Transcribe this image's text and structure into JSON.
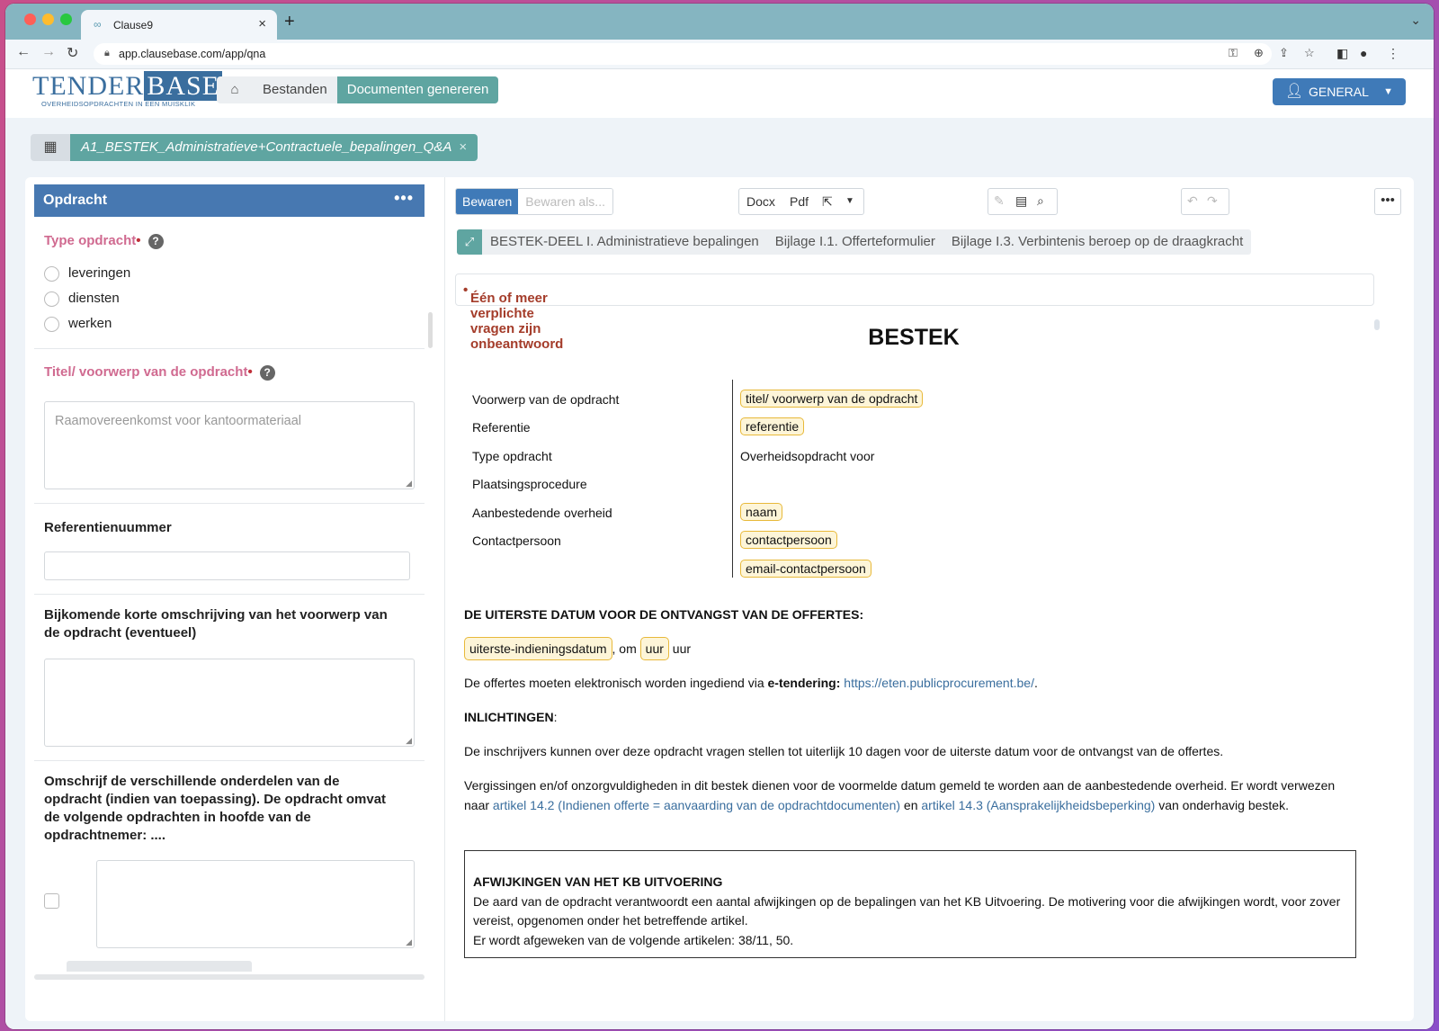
{
  "browser": {
    "tab_title": "Clause9",
    "url": "app.clausebase.com/app/qna"
  },
  "header": {
    "logo_main": "TENDER",
    "logo_accent": "BASE",
    "logo_tagline": "OVERHEIDSOPDRACHTEN IN EEN MUISKLIK",
    "nav_files": "Bestanden",
    "nav_generate": "Documenten genereren",
    "user_label": "GENERAL"
  },
  "document_tab": "A1_BESTEK_Administratieve+Contractuele_bepalingen_Q&A",
  "left_panel": {
    "title": "Opdracht",
    "q_type": "Type opdracht",
    "q_type_options": [
      "leveringen",
      "diensten",
      "werken"
    ],
    "q_title": "Titel/ voorwerp van de opdracht",
    "q_title_placeholder": "Raamovereenkomst voor kantoormateriaal",
    "q_reference": "Referentienuummer",
    "q_short_desc": "Bijkomende korte omschrijving van het voorwerp van de opdracht (eventueel)",
    "q_parts": "Omschrijf de verschillende onderdelen van de opdracht (indien van toepassing). De opdracht omvat de volgende opdrachten in hoofde van de opdrachtnemer: ...."
  },
  "toolbar": {
    "save": "Bewaren",
    "save_as": "Bewaren als...",
    "docx": "Docx",
    "pdf": "Pdf"
  },
  "section_tabs": [
    "BESTEK-DEEL I. Administratieve bepalingen",
    "Bijlage I.1. Offerteformulier",
    "Bijlage I.3. Verbintenis beroep op de draagkracht"
  ],
  "warning": "Één of meer verplichte vragen zijn onbeantwoord",
  "document": {
    "title": "BESTEK",
    "rows": [
      {
        "label": "Voorwerp van de opdracht",
        "value": "titel/ voorwerp van de opdracht",
        "hl": true
      },
      {
        "label": "Referentie",
        "value": "referentie",
        "hl": true
      },
      {
        "label": "Type opdracht",
        "value": "Overheidsopdracht voor",
        "hl": false
      },
      {
        "label": "Plaatsingsprocedure",
        "value": "",
        "hl": false
      },
      {
        "label": "Aanbestedende overheid",
        "value": "naam",
        "hl": true
      },
      {
        "label": "Contactpersoon",
        "value": "contactpersoon",
        "hl": true
      },
      {
        "label": "",
        "value": "email-contactpersoon",
        "hl": true
      }
    ],
    "deadline_heading": "DE UITERSTE DATUM VOOR DE ONTVANGST VAN DE OFFERTES:",
    "deadline_date": "uiterste-indieningsdatum",
    "deadline_om": ", om",
    "deadline_hour": "uur",
    "deadline_suffix": "uur",
    "submit_text": "De offertes moeten elektronisch worden ingediend via",
    "submit_bold": "e-tendering:",
    "submit_link": "https://eten.publicprocurement.be/",
    "submit_end": ".",
    "info_heading": "INLICHTINGEN",
    "info_colon": ":",
    "info_text": "De inschrijvers kunnen over deze opdracht vragen stellen tot uiterlijk 10 dagen voor de uiterste datum voor de ontvangst van de offertes.",
    "errors_text1": "Vergissingen en/of onzorgvuldigheden in dit bestek dienen voor de voormelde datum gemeld te worden aan de aanbestedende overheid. Er wordt verwezen naar",
    "errors_link1": "artikel 14.2 (Indienen offerte = aanvaarding van de opdrachtdocumenten)",
    "errors_en": "en",
    "errors_link2": "artikel 14.3 (Aansprakelijkheidsbeperking)",
    "errors_text2": "van onderhavig bestek.",
    "box_heading": "AFWIJKINGEN VAN HET KB UITVOERING",
    "box_text1": "De aard van de opdracht verantwoordt een aantal afwijkingen op de bepalingen van het KB Uitvoering. De motivering voor die afwijkingen wordt, voor zover vereist, opgenomen onder het betreffende artikel.",
    "box_text2": "Er wordt afgeweken van de volgende artikelen: 38/11, 50."
  },
  "colors": {
    "primary": "#3f7ab8",
    "teal": "#5fa5a1",
    "required_label": "#d06a90",
    "warning": "#a43c2a",
    "highlight_border": "#e8b93a"
  }
}
